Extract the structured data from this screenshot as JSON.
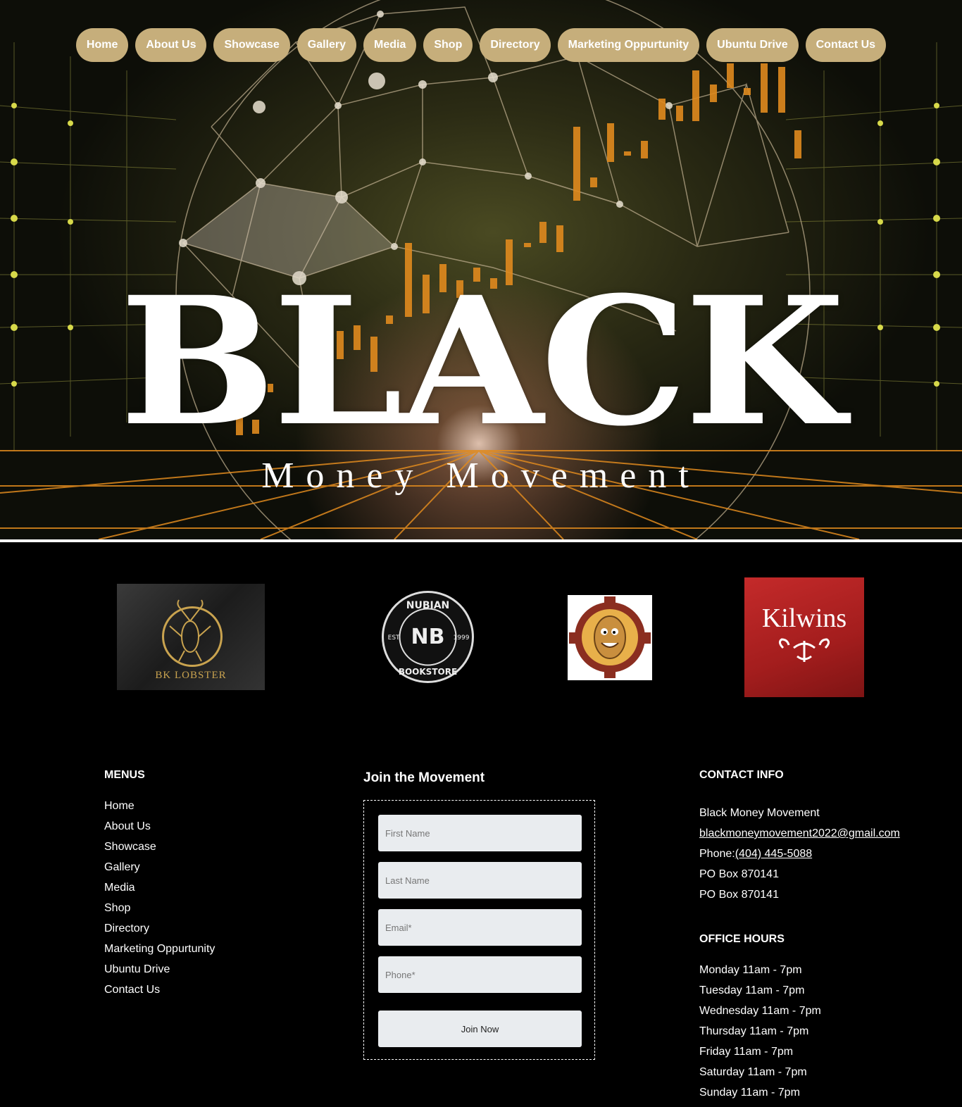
{
  "nav": {
    "items": [
      "Home",
      "About Us",
      "Showcase",
      "Gallery",
      "Media",
      "Shop",
      "Directory",
      "Marketing Oppurtunity",
      "Ubuntu Drive",
      "Contact Us"
    ]
  },
  "hero": {
    "title": "BLACK",
    "subtitle": "Money Movement"
  },
  "partners": {
    "lobster_name": "BK LOBSTER",
    "nubian_top": "NUBIAN",
    "nubian_mark": "NB",
    "nubian_bottom": "BOOKSTORE",
    "nubian_est": "EST.",
    "nubian_year": "1999",
    "kilwins_name": "Kilwins"
  },
  "footer": {
    "menus_title": "MENUS",
    "menu_items": [
      "Home",
      "About Us",
      "Showcase",
      "Gallery",
      "Media",
      "Shop",
      "Directory",
      "Marketing Oppurtunity",
      "Ubuntu Drive",
      "Contact Us"
    ],
    "join_title": "Join the Movement",
    "form": {
      "first_name_placeholder": "First Name",
      "last_name_placeholder": "Last Name",
      "email_placeholder": "Email*",
      "phone_placeholder": "Phone*",
      "submit_label": "Join Now"
    },
    "contact_title": "CONTACT INFO",
    "contact": {
      "org": "Black Money Movement",
      "email": "blackmoneymovement2022@gmail.com",
      "phone_label": "Phone:",
      "phone": "(404) 445-5088",
      "po_box_1": "PO Box 870141",
      "po_box_2": "PO Box 870141"
    },
    "hours_title": "OFFICE HOURS",
    "hours": [
      "Monday 11am - 7pm",
      "Tuesday 11am - 7pm",
      "Wednesday 11am - 7pm",
      "Thursday 11am - 7pm",
      "Friday 11am - 7pm",
      "Saturday 11am - 7pm",
      "Sunday 11am - 7pm"
    ]
  },
  "colors": {
    "nav_pill": "#c6ae7b",
    "background": "#000000",
    "candle_orange": "#e08a1e",
    "kilwins_red": "#b22222"
  }
}
